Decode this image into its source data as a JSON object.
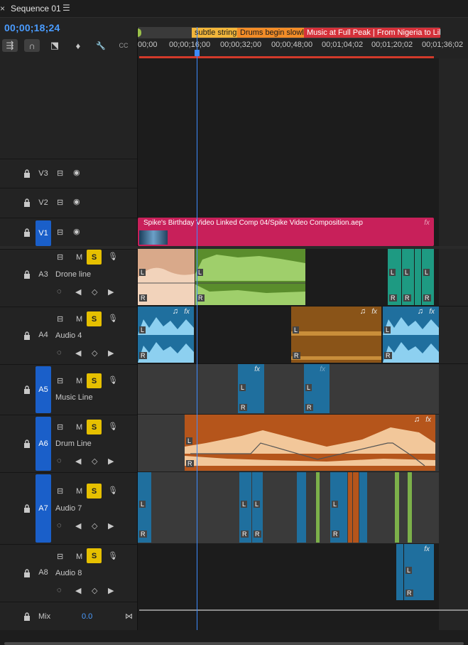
{
  "window": {
    "close_glyph": "×",
    "title": "Sequence 01",
    "menu_glyph": "☰"
  },
  "timecode": "00;00;18;24",
  "toolbar": [
    {
      "name": "insert-overwrite-icon",
      "glyph": "⇶",
      "active": true
    },
    {
      "name": "snap-icon",
      "glyph": "∩",
      "active": true
    },
    {
      "name": "linked-selection-icon",
      "glyph": "⬔",
      "active": false
    },
    {
      "name": "add-marker-icon",
      "glyph": "♦",
      "active": false
    },
    {
      "name": "wrench-icon",
      "glyph": "🔧",
      "active": false
    },
    {
      "name": "captions-icon",
      "glyph": "CC",
      "active": false
    }
  ],
  "markers": [
    {
      "label": "subtle strings",
      "color": "#f2b63b"
    },
    {
      "label": "Drums begin slowly",
      "color": "#f28c28"
    },
    {
      "label": "Music at Full Peak | From Nigeria to Libya",
      "color": "#d5313a"
    }
  ],
  "ruler_ticks": [
    "00;00",
    "00;00;16;00",
    "00;00;32;00",
    "00;00;48;00",
    "00;01;04;02",
    "00;01;20;02",
    "00;01;36;02"
  ],
  "video_tracks": [
    {
      "id": "V3",
      "targeted": false
    },
    {
      "id": "V2",
      "targeted": false
    },
    {
      "id": "V1",
      "targeted": true
    }
  ],
  "audio_tracks": [
    {
      "id": "A3",
      "name": "Drone line",
      "targeted": false
    },
    {
      "id": "A4",
      "name": "Audio 4",
      "targeted": false
    },
    {
      "id": "A5",
      "name": "Music Line",
      "targeted": true
    },
    {
      "id": "A6",
      "name": "Drum Line",
      "targeted": true
    },
    {
      "id": "A7",
      "name": "Audio 7",
      "targeted": true
    },
    {
      "id": "A8",
      "name": "Audio 8",
      "targeted": false
    }
  ],
  "track_buttons": {
    "mute": "M",
    "solo": "S"
  },
  "video_clip": {
    "label": "Spike's Birthday Video Linked Comp 04/Spike Video Composition.aep",
    "fx": "fx"
  },
  "mix": {
    "label": "Mix",
    "value": "0.0"
  },
  "clip_labels": {
    "left": "L",
    "right": "R",
    "fx": "fx",
    "note": "♫"
  },
  "colors": {
    "accent": "#1a5fc9",
    "solo": "#e6c000",
    "playhead": "#3d8bff",
    "video_clip": "#c8205a",
    "drone_clip_a": "#d9a98a",
    "drone_clip_b": "#7cb04a",
    "teal_clip": "#1e9a82",
    "blue_clip": "#1f6f9e",
    "brown_clip": "#8a5418",
    "orange_clip": "#b5551b"
  }
}
